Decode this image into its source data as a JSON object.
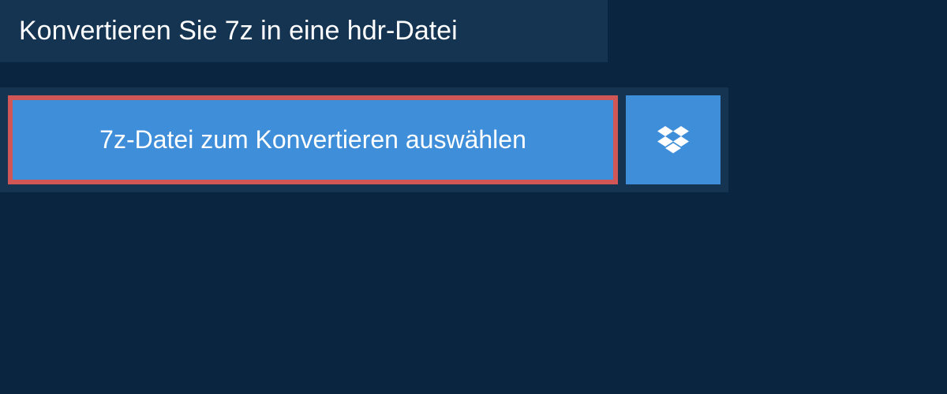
{
  "header": {
    "title": "Konvertieren Sie 7z in eine hdr-Datei"
  },
  "upload": {
    "select_button_label": "7z-Datei zum Konvertieren auswählen"
  },
  "colors": {
    "background": "#0a2540",
    "panel": "#153451",
    "button": "#3f8ed9",
    "highlight_border": "#d15757"
  }
}
